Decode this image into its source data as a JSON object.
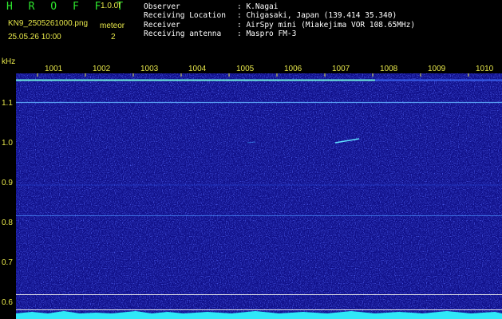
{
  "header": {
    "brand": "H R O F F T",
    "version": "1.0.0f",
    "filename": "KN9_2505261000.png",
    "mode": "meteor",
    "datetime": "25.05.26 10:00",
    "count": "2",
    "info": [
      {
        "key": "Observer",
        "value": ": K.Nagai"
      },
      {
        "key": "Receiving Location",
        "value": ": Chigasaki, Japan (139.414 35.340)"
      },
      {
        "key": "Receiver",
        "value": ": AirSpy mini (Miakejima VOR 108.65MHz)"
      },
      {
        "key": "Receiving antenna",
        "value": ": Maspro FM-3"
      }
    ]
  },
  "axes": {
    "y_unit": "kHz",
    "x_ticks": [
      "1001",
      "1002",
      "1003",
      "1004",
      "1005",
      "1006",
      "1007",
      "1008",
      "1009",
      "1010"
    ],
    "y_ticks": [
      "1.1",
      "1.0",
      "0.9",
      "0.8",
      "0.7",
      "0.6"
    ]
  },
  "colors": {
    "background": "#000000",
    "waterfall": "#10108a",
    "label": "#e8e84a",
    "brand": "#2ee82e",
    "signal": "#40e0f0"
  }
}
